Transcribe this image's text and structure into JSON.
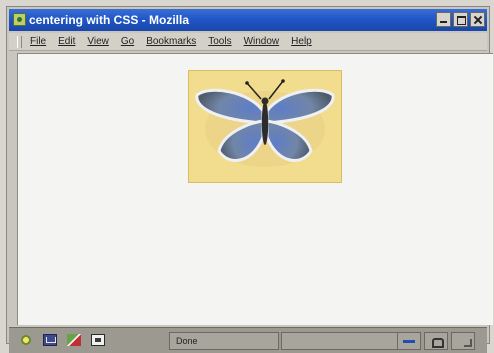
{
  "window": {
    "title": "centering with CSS - Mozilla"
  },
  "menubar": {
    "items": [
      "File",
      "Edit",
      "View",
      "Go",
      "Bookmarks",
      "Tools",
      "Window",
      "Help"
    ]
  },
  "content": {
    "image": "butterfly-image"
  },
  "statusbar": {
    "status_text": "Done",
    "icons": [
      "navigator-icon",
      "mail-icon",
      "composer-icon",
      "address-book-icon"
    ],
    "indicators": [
      "online-status-icon",
      "security-lock-icon",
      "resize-grip-icon"
    ]
  },
  "colors": {
    "titlebar": "#1f55c4",
    "content_bg": "#f4f4f2",
    "image_bg": "#f2dc8e"
  }
}
